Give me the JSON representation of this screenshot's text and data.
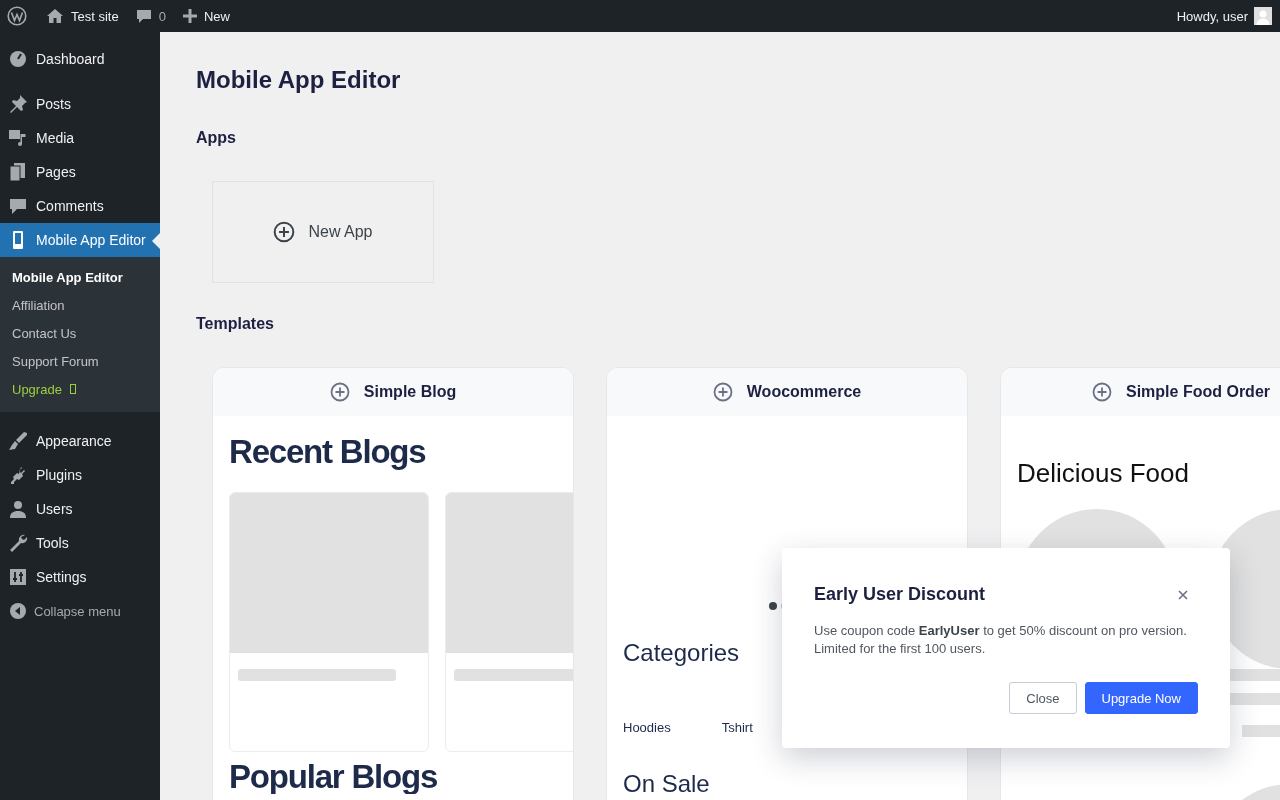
{
  "admin_bar": {
    "site": "Test site",
    "comments": "0",
    "new": "New",
    "greeting": "Howdy, user"
  },
  "sidebar": {
    "items": [
      {
        "label": "Dashboard",
        "selected": false
      },
      {
        "label": "Posts",
        "selected": false
      },
      {
        "label": "Media",
        "selected": false
      },
      {
        "label": "Pages",
        "selected": false
      },
      {
        "label": "Comments",
        "selected": false
      },
      {
        "label": "Mobile App Editor",
        "selected": true,
        "children": [
          {
            "label": "Mobile App Editor",
            "kind": "link",
            "selected": true
          },
          {
            "label": "Affiliation",
            "kind": "link",
            "selected": false
          },
          {
            "label": "Contact Us",
            "kind": "link",
            "selected": false
          },
          {
            "label": "Support Forum",
            "kind": "link",
            "selected": false
          },
          {
            "label": "Upgrade",
            "kind": "upgrade",
            "selected": false
          }
        ]
      },
      {
        "label": "Appearance",
        "selected": false
      },
      {
        "label": "Plugins",
        "selected": false
      },
      {
        "label": "Users",
        "selected": false
      },
      {
        "label": "Tools",
        "selected": false
      },
      {
        "label": "Settings",
        "selected": false
      }
    ],
    "collapse": "Collapse menu"
  },
  "page": {
    "title": "Mobile App Editor",
    "apps_heading": "Apps",
    "new_app": "New App",
    "templates_heading": "Templates",
    "templates": [
      {
        "name": "Simple Blog",
        "kind": "blog",
        "heading": "Recent Blogs",
        "second_heading": "Popular Blogs"
      },
      {
        "name": "Woocommerce",
        "kind": "shop",
        "heading": "Categories",
        "categories": [
          "Hoodies",
          "Tshirt"
        ],
        "second_heading": "On Sale"
      },
      {
        "name": "Simple Food Order",
        "kind": "food",
        "heading": "Delicious Food"
      }
    ]
  },
  "dialog": {
    "title": "Early User Discount",
    "message": "Use coupon code **EarlyUser** to get 50% discount on pro version.\nLimited for the first 100 users.",
    "buttons": [
      {
        "label": "Close",
        "kind": "secondary"
      },
      {
        "label": "Upgrade Now",
        "kind": "primary"
      }
    ]
  }
}
